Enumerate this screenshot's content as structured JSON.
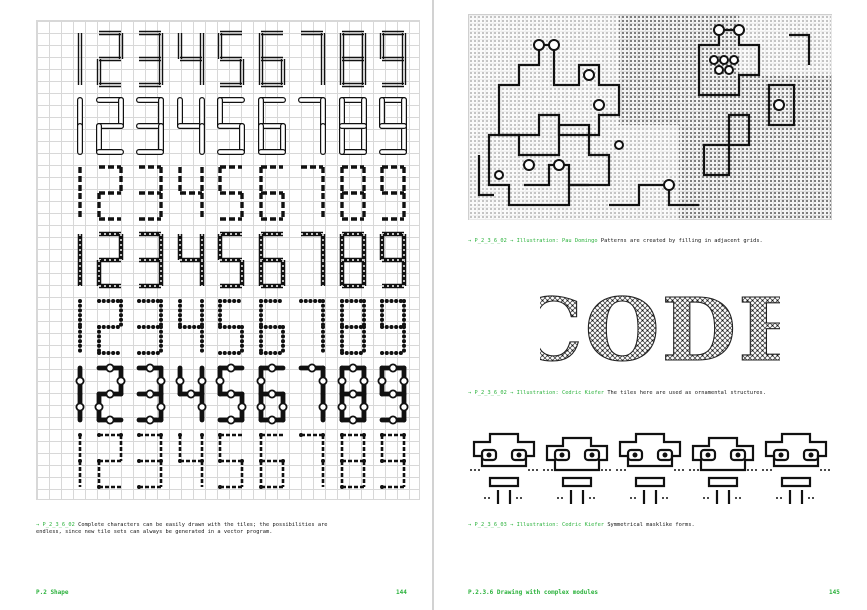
{
  "left_page": {
    "digit_rows": [
      {
        "style": "thin-double",
        "digits": [
          "1",
          "2",
          "3",
          "4",
          "5",
          "6",
          "7",
          "8",
          "9"
        ]
      },
      {
        "style": "hollow-rounded",
        "digits": [
          "1",
          "2",
          "3",
          "4",
          "5",
          "6",
          "7",
          "8",
          "9"
        ]
      },
      {
        "style": "dashed",
        "digits": [
          "1",
          "2",
          "3",
          "4",
          "5",
          "6",
          "7",
          "8",
          "9"
        ]
      },
      {
        "style": "crossed-chain",
        "digits": [
          "1",
          "2",
          "3",
          "4",
          "5",
          "6",
          "7",
          "8",
          "9"
        ]
      },
      {
        "style": "dotted-stroke",
        "digits": [
          "1",
          "2",
          "3",
          "4",
          "5",
          "6",
          "7",
          "8",
          "9"
        ]
      },
      {
        "style": "bold-beaded",
        "digits": [
          "1",
          "2",
          "3",
          "4",
          "5",
          "6",
          "7",
          "8",
          "9"
        ]
      },
      {
        "style": "arrow-ends",
        "digits": [
          "1",
          "2",
          "3",
          "4",
          "5",
          "6",
          "7",
          "8",
          "9"
        ]
      }
    ],
    "caption": {
      "arrow": "→",
      "ref": "P_2_3_6_02",
      "text": "Complete characters can be easily drawn with the tiles; the possibilities are endless, since new tile sets can always be generated in a vector program."
    },
    "footer": {
      "section": "P.2 Shape",
      "page_number": "144"
    }
  },
  "right_page": {
    "figure1_caption": {
      "arrow": "→",
      "ref": "P_2_3_6_02 → Illustration: Pau Domingo",
      "text": "Patterns are created by filling in adjacent grids."
    },
    "figure2_caption": {
      "arrow": "→",
      "ref": "P_2_3_6_02 → Illustration: Cedric Kiefer",
      "text": "The tiles here are used as ornamental structures."
    },
    "figure3_caption": {
      "arrow": "→",
      "ref": "P_2_3_6_03 → Illustration: Cedric Kiefer",
      "text": "Symmetrical masklike forms."
    },
    "code_word": "CODE",
    "footer": {
      "section": "P.2.3.6 Drawing with complex modules",
      "page_number": "145"
    }
  },
  "colors": {
    "accent_green": "#2bb23c",
    "ink": "#111111",
    "grid": "#d8d8d8"
  }
}
